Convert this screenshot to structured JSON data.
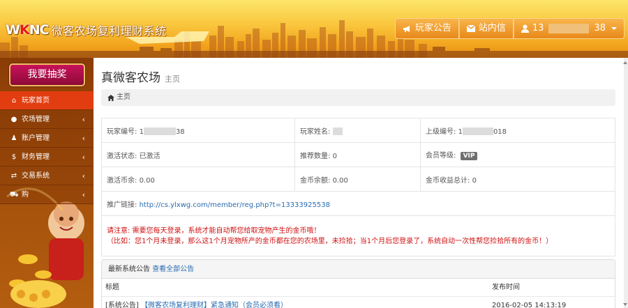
{
  "header": {
    "logo_badge_w": "W",
    "logo_badge_k": "K",
    "logo_badge_nc": "NC",
    "logo_text": "微客农场复利理财系统",
    "nav": {
      "announcement": "玩家公告",
      "mail": "站内信",
      "user_prefix": "13",
      "user_suffix": "38"
    }
  },
  "sidebar": {
    "draw_button": "我要抽奖",
    "items": [
      {
        "label": "玩家首页",
        "icon": "home-icon",
        "active": true
      },
      {
        "label": "农场管理",
        "icon": "piggy-bank-icon"
      },
      {
        "label": "账户管理",
        "icon": "user-icon"
      },
      {
        "label": "财务管理",
        "icon": "dollar-icon"
      },
      {
        "label": "交易系统",
        "icon": "exchange-icon"
      },
      {
        "label": "购",
        "icon": "cart-icon"
      }
    ]
  },
  "main": {
    "title": "真微客农场",
    "subtitle": "主页",
    "breadcrumb": "主页",
    "info": {
      "player_id_label": "玩家编号:",
      "player_id_prefix": "1",
      "player_id_suffix": "38",
      "player_name_label": "玩家姓名:",
      "parent_id_label": "上级编号:",
      "parent_id_prefix": "1",
      "parent_id_suffix": "018",
      "activation_label": "激活状态:",
      "activation_value": "已激活",
      "referrals_label": "推荐数量:",
      "referrals_value": "0",
      "level_label": "会员等级:",
      "level_value": "VIP",
      "activation_coin_label": "激活币余:",
      "activation_coin_value": "0.00",
      "gold_balance_label": "金币余额:",
      "gold_balance_value": "0.00",
      "gold_total_label": "金币收益总计:",
      "gold_total_value": "0",
      "referral_link_label": "推广链接:",
      "referral_link": "http://cs.ylxwg.com/member/reg.php?t=13333925538",
      "notice_line1": "请注意: 需要您每天登录，系统才能自动帮您给取宠物产生的金币哦！",
      "notice_line2": "（比如：您1个月未登录，那么这1个月宠物所产的金币都在您的农场里，未捡拾；当1个月后您登录了，系统自动一次性帮您捡拾所有的金币！）"
    },
    "announcements": {
      "header_label": "最新系统公告",
      "view_all": "查看全部公告",
      "col_title": "标题",
      "col_time": "发布时间",
      "rows": [
        {
          "category": "[系统公告]",
          "title": "【微客农场复利理财】紧急通知（会员必须看）",
          "time": "2016-02-05 14:13:19"
        }
      ]
    }
  }
}
